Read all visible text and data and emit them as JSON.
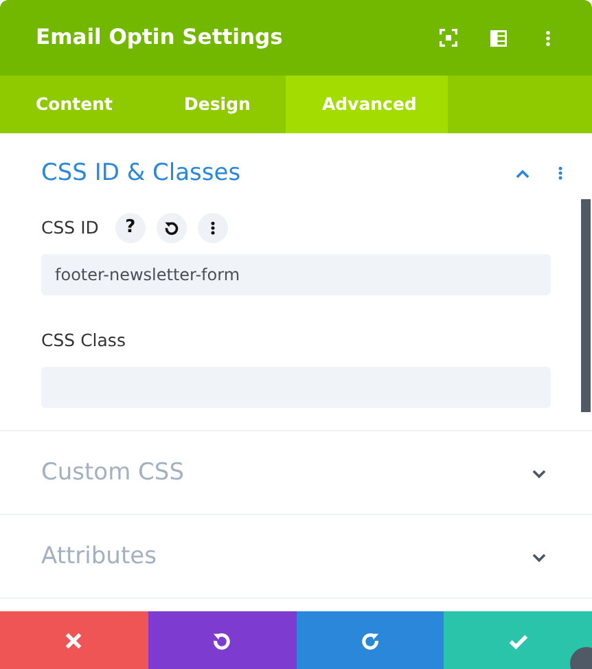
{
  "window": {
    "title": "Email Optin Settings"
  },
  "tabs": [
    {
      "label": "Content",
      "selected": false
    },
    {
      "label": "Design",
      "selected": false
    },
    {
      "label": "Advanced",
      "selected": true
    }
  ],
  "sections": [
    {
      "title": "CSS ID & Classes",
      "expanded": true,
      "fields": [
        {
          "label": "CSS ID",
          "value": "footer-newsletter-form",
          "help": "?"
        },
        {
          "label": "CSS Class"
        }
      ]
    },
    {
      "title": "Custom CSS",
      "expanded": false
    },
    {
      "title": "Attributes",
      "expanded": false
    }
  ],
  "footer_buttons": [
    {
      "kind": "discard",
      "color": "#ef5555"
    },
    {
      "kind": "undo",
      "color": "#7e3bd0"
    },
    {
      "kind": "redo",
      "color": "#2b87da"
    },
    {
      "kind": "save",
      "color": "#29c4a9"
    }
  ]
}
